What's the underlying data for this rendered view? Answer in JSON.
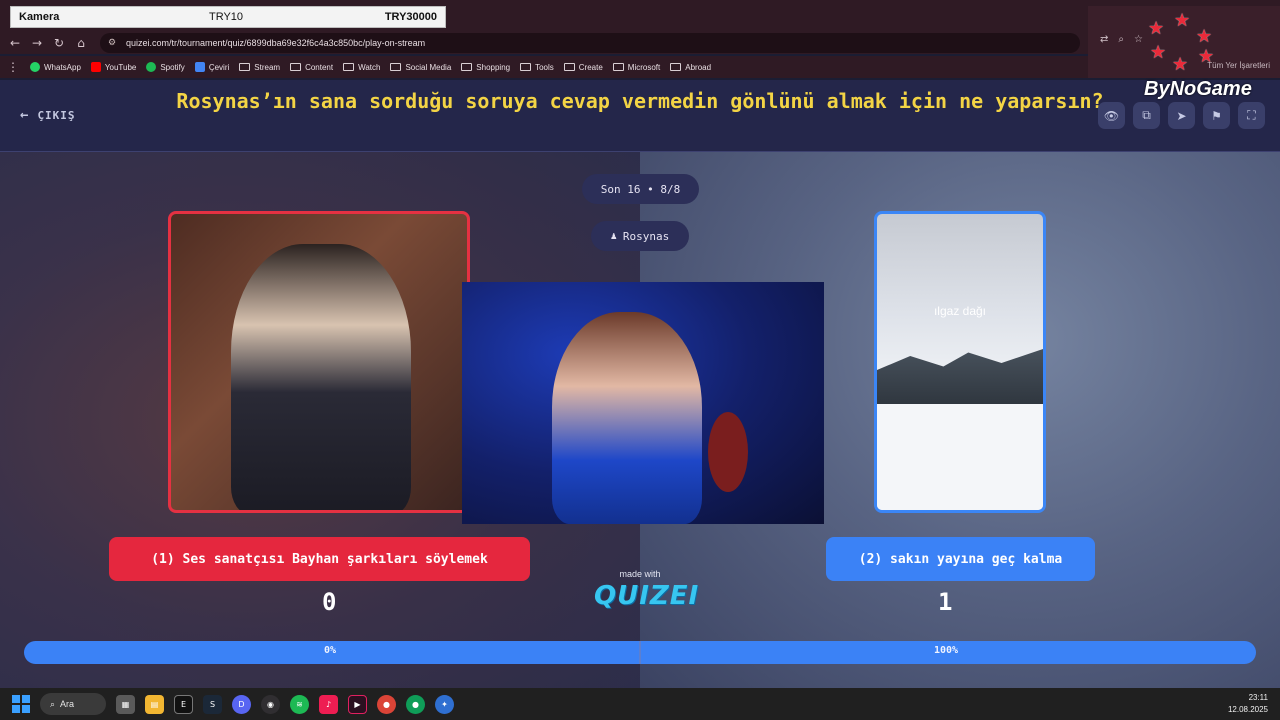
{
  "overlay": {
    "camera_label": "Kamera",
    "try10": "TRY10",
    "try30000": "TRY30000"
  },
  "browser": {
    "url": "quizei.com/tr/tournament/quiz/6899dba69e32f6c4a3c850bc/play-on-stream",
    "bookmarks": [
      {
        "label": "WhatsApp",
        "color": "#25d366"
      },
      {
        "label": "YouTube",
        "color": "#ff0000"
      },
      {
        "label": "Spotify",
        "color": "#1db954"
      },
      {
        "label": "Çeviri",
        "color": "#4285f4"
      },
      {
        "label": "Stream",
        "color": "folder"
      },
      {
        "label": "Content",
        "color": "folder"
      },
      {
        "label": "Watch",
        "color": "folder"
      },
      {
        "label": "Social Media",
        "color": "folder"
      },
      {
        "label": "Shopping",
        "color": "folder"
      },
      {
        "label": "Tools",
        "color": "folder"
      },
      {
        "label": "Create",
        "color": "folder"
      },
      {
        "label": "Microsoft",
        "color": "folder"
      },
      {
        "label": "Abroad",
        "color": "folder"
      }
    ],
    "all_bookmarks": "Tüm Yer İşaretleri"
  },
  "header": {
    "exit_label": "ÇIKIŞ",
    "question": "Rosynas’ın sana sorduğu soruya cevap vermedin gönlünü almak için ne yaparsın?",
    "icons": [
      "eye-icon",
      "share-icon",
      "send-icon",
      "flag-icon",
      "fullscreen-icon"
    ]
  },
  "round": {
    "label": "Son 16 • 8/8",
    "host": "Rosynas"
  },
  "options": {
    "left": {
      "label": "(1) Ses sanatçısı Bayhan şarkıları söylemek",
      "votes": "0",
      "percent": "0%",
      "color": "#e5273e"
    },
    "right": {
      "label": "(2) sakın yayına geç kalma",
      "votes": "1",
      "percent": "100%",
      "image_caption": "ılgaz dağı",
      "color": "#3b82f6"
    }
  },
  "branding": {
    "made_with": "made with",
    "logo": "QUIZEI",
    "watermark": "ByNoGame"
  },
  "taskbar": {
    "search_label": "Ara",
    "time": "23:11",
    "date": "12.08.2025"
  }
}
